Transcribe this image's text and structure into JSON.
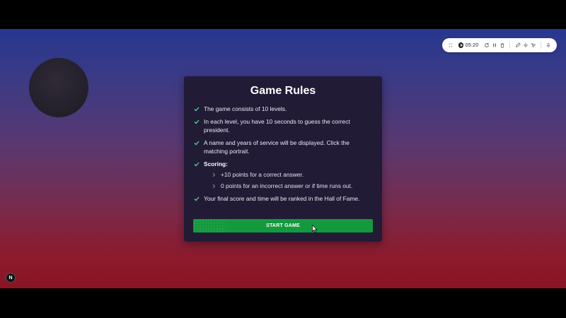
{
  "toolbar": {
    "timer": "05:20",
    "icons": [
      "drag-handle-icon",
      "play-icon",
      "restart-icon",
      "pause-icon",
      "trash-icon",
      "pencil-icon",
      "settings-icon",
      "cursor-icon",
      "mic-icon"
    ]
  },
  "card": {
    "title": "Game Rules",
    "rules": [
      "The game consists of 10 levels.",
      "In each level, you have 10 seconds to guess the correct president.",
      "A name and years of service will be displayed. Click the matching portrait.",
      "Scoring:",
      "Your final score and time will be ranked in the Hall of Fame."
    ],
    "scoring_items": [
      "+10 points for a correct answer.",
      "0 points for an incorrect answer or if time runs out."
    ],
    "start_button": "START GAME"
  },
  "badge": {
    "label": "N"
  },
  "colors": {
    "accent": "#149a3e",
    "check": "#4ade80",
    "card_bg": "#221b36",
    "bg_top": "#27378f",
    "bg_bottom": "#8a1424"
  }
}
